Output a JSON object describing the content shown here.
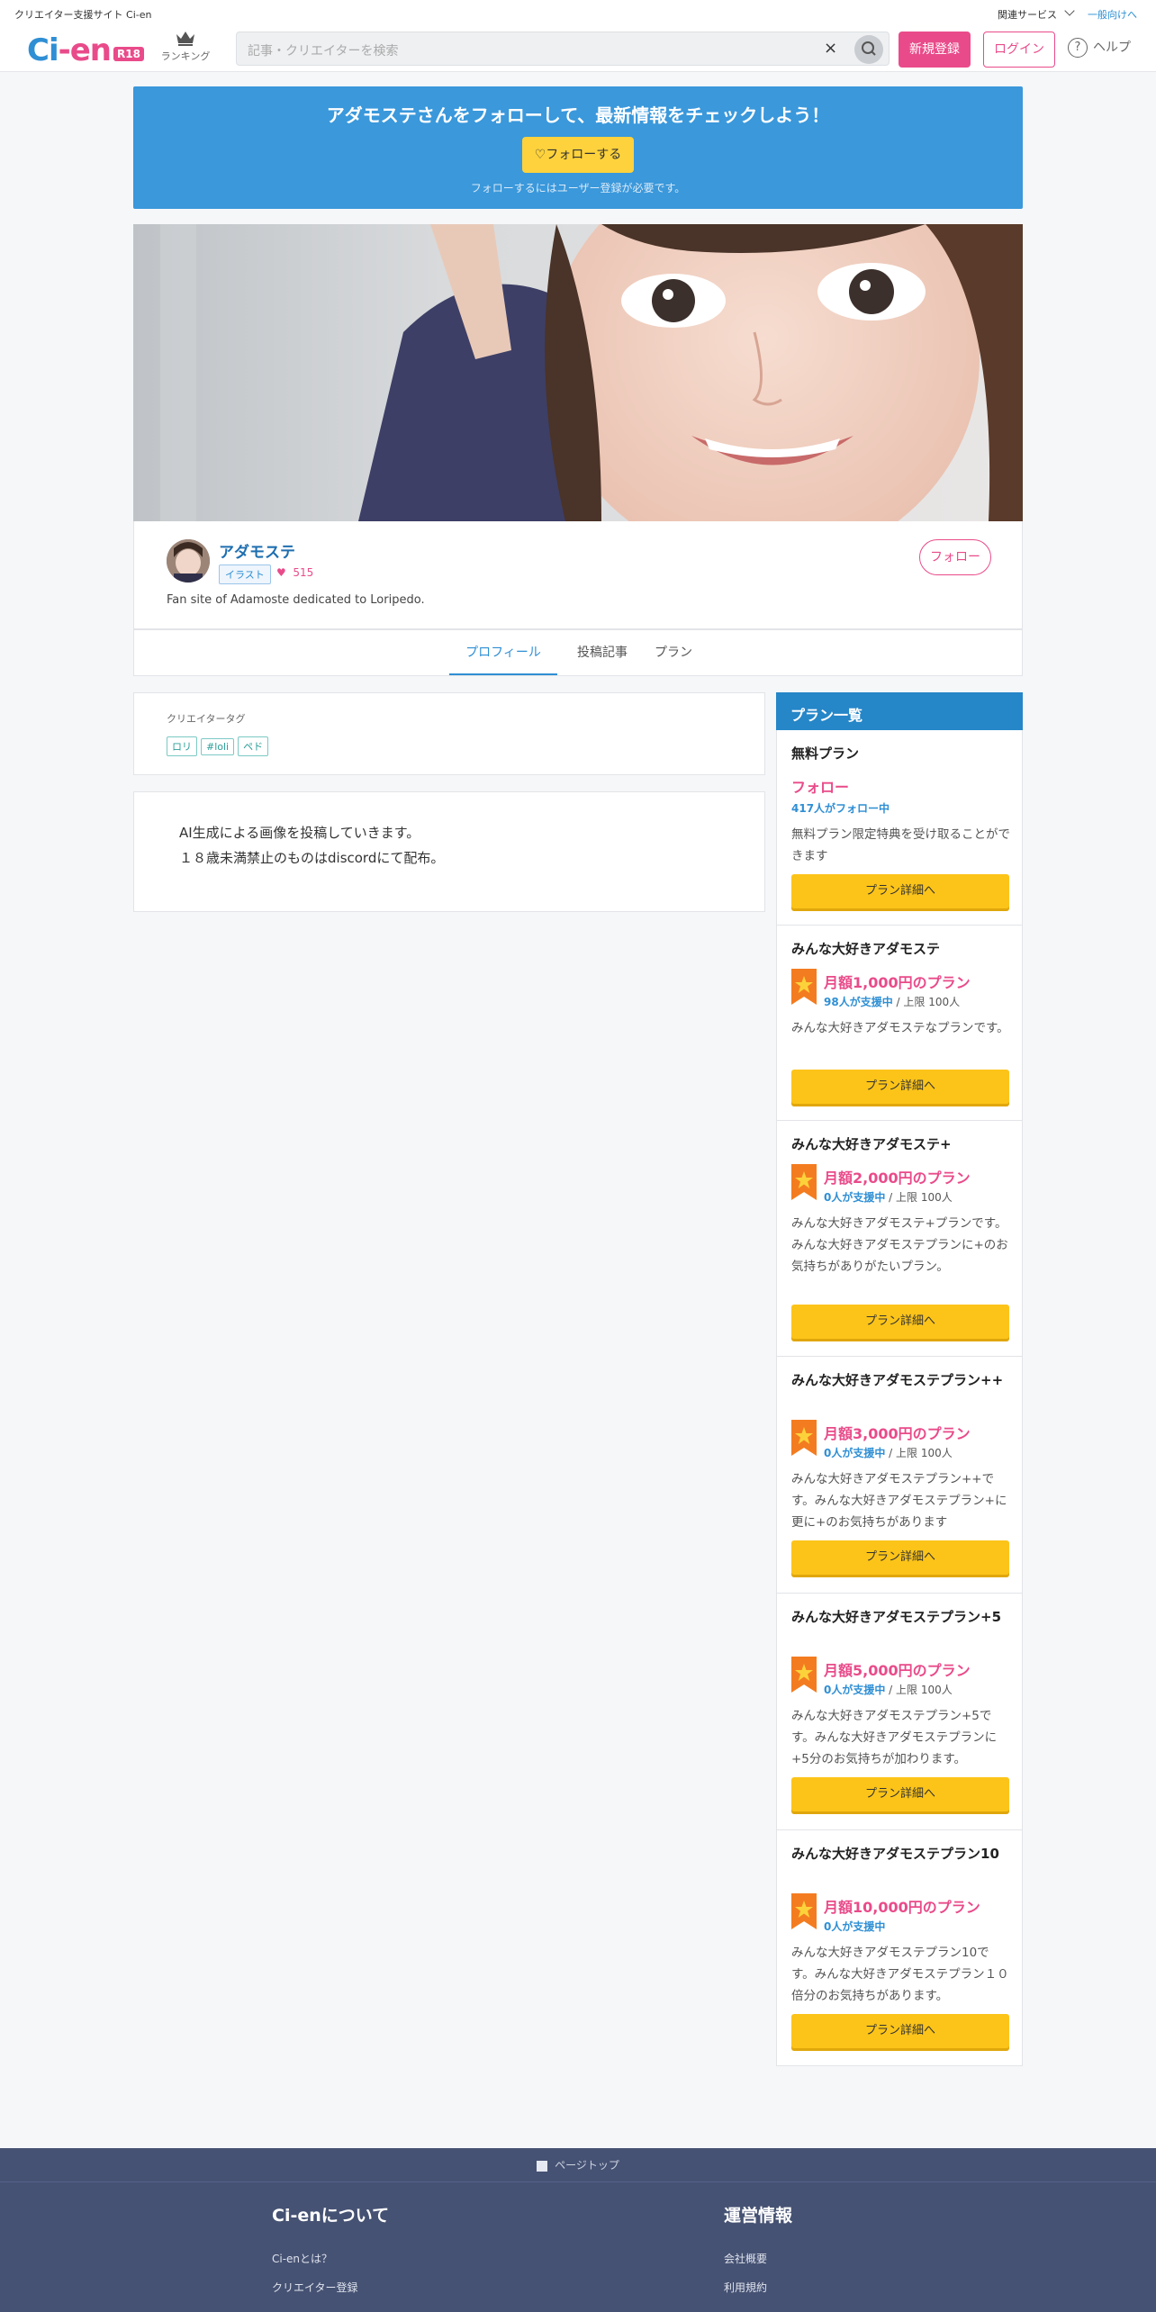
{
  "util": {
    "site": "クリエイター支援サイト Ci-en",
    "related": "関連サービス",
    "general": "一般向けへ"
  },
  "header": {
    "logo_ci": "Ci",
    "logo_dot": "-",
    "logo_en": "en",
    "logo_badge": "R18",
    "ranking": "ランキング",
    "search_placeholder": "記事・クリエイターを検索",
    "clear": "×",
    "register": "新規登録",
    "login": "ログイン",
    "help": "ヘルプ",
    "help_q": "?"
  },
  "banner": {
    "title": "アダモステさんをフォローして、最新情報をチェックしよう！",
    "follow": "♡フォローする",
    "note": "フォローするにはユーザー登録が必要です。"
  },
  "profile": {
    "name": "アダモステ",
    "tag": "イラスト",
    "likes": "515",
    "description": "Fan site of Adamoste dedicated to Loripedo.",
    "follow": "フォロー"
  },
  "tabs": [
    "プロフィール",
    "投稿記事",
    "プラン"
  ],
  "creator_tags": {
    "label": "クリエイタータグ",
    "tags": [
      "ロリ",
      "#loli",
      "ペド"
    ]
  },
  "about": {
    "lines": [
      "AI生成による画像を投稿していきます。",
      "１８歳未満禁止のものはdiscordにて配布。"
    ]
  },
  "plans": {
    "heading": "プラン一覧",
    "button": "プラン詳細へ",
    "items": [
      {
        "name": "無料プラン",
        "price": "フォロー",
        "supporters": "417人がフォロー中",
        "limit": "",
        "desc": "無料プラン限定特典を受け取ることができます"
      },
      {
        "name": "みんな大好きアダモステ",
        "price": "月額1,000円のプラン",
        "supporters": "98人が支援中",
        "limit": " / 上限 100人",
        "desc": "みんな大好きアダモステなプランです。"
      },
      {
        "name": "みんな大好きアダモステ+",
        "price": "月額2,000円のプラン",
        "supporters": "0人が支援中",
        "limit": " / 上限 100人",
        "desc": "みんな大好きアダモステ+プランです。みんな大好きアダモステプランに+のお気持ちがありがたいプラン。"
      },
      {
        "name": "みんな大好きアダモステプラン++",
        "price": "月額3,000円のプラン",
        "supporters": "0人が支援中",
        "limit": " / 上限 100人",
        "desc": "みんな大好きアダモステプラン++です。みんな大好きアダモステプラン+に更に+のお気持ちがあります"
      },
      {
        "name": "みんな大好きアダモステプラン+5",
        "price": "月額5,000円のプラン",
        "supporters": "0人が支援中",
        "limit": " / 上限 100人",
        "desc": "みんな大好きアダモステプラン+5です。みんな大好きアダモステプランに+5分のお気持ちが加わります。"
      },
      {
        "name": "みんな大好きアダモステプラン10",
        "price": "月額10,000円のプラン",
        "supporters": "0人が支援中",
        "limit": "",
        "desc": "みんな大好きアダモステプラン10です。みんな大好きアダモステプラン１０倍分のお気持ちがあります。"
      }
    ]
  },
  "footer": {
    "pagetop": "ページトップ",
    "about_heading": "Ci-enについて",
    "about_links": [
      "Ci-enとは？",
      "クリエイター登録"
    ],
    "ops_heading": "運営情報",
    "ops_links": [
      "会社概要",
      "利用規約"
    ]
  },
  "colors": {
    "brand_blue": "#2f8fd4",
    "brand_pink": "#e94b8a",
    "cta_yellow": "#fcc419",
    "footer": "#465273"
  }
}
